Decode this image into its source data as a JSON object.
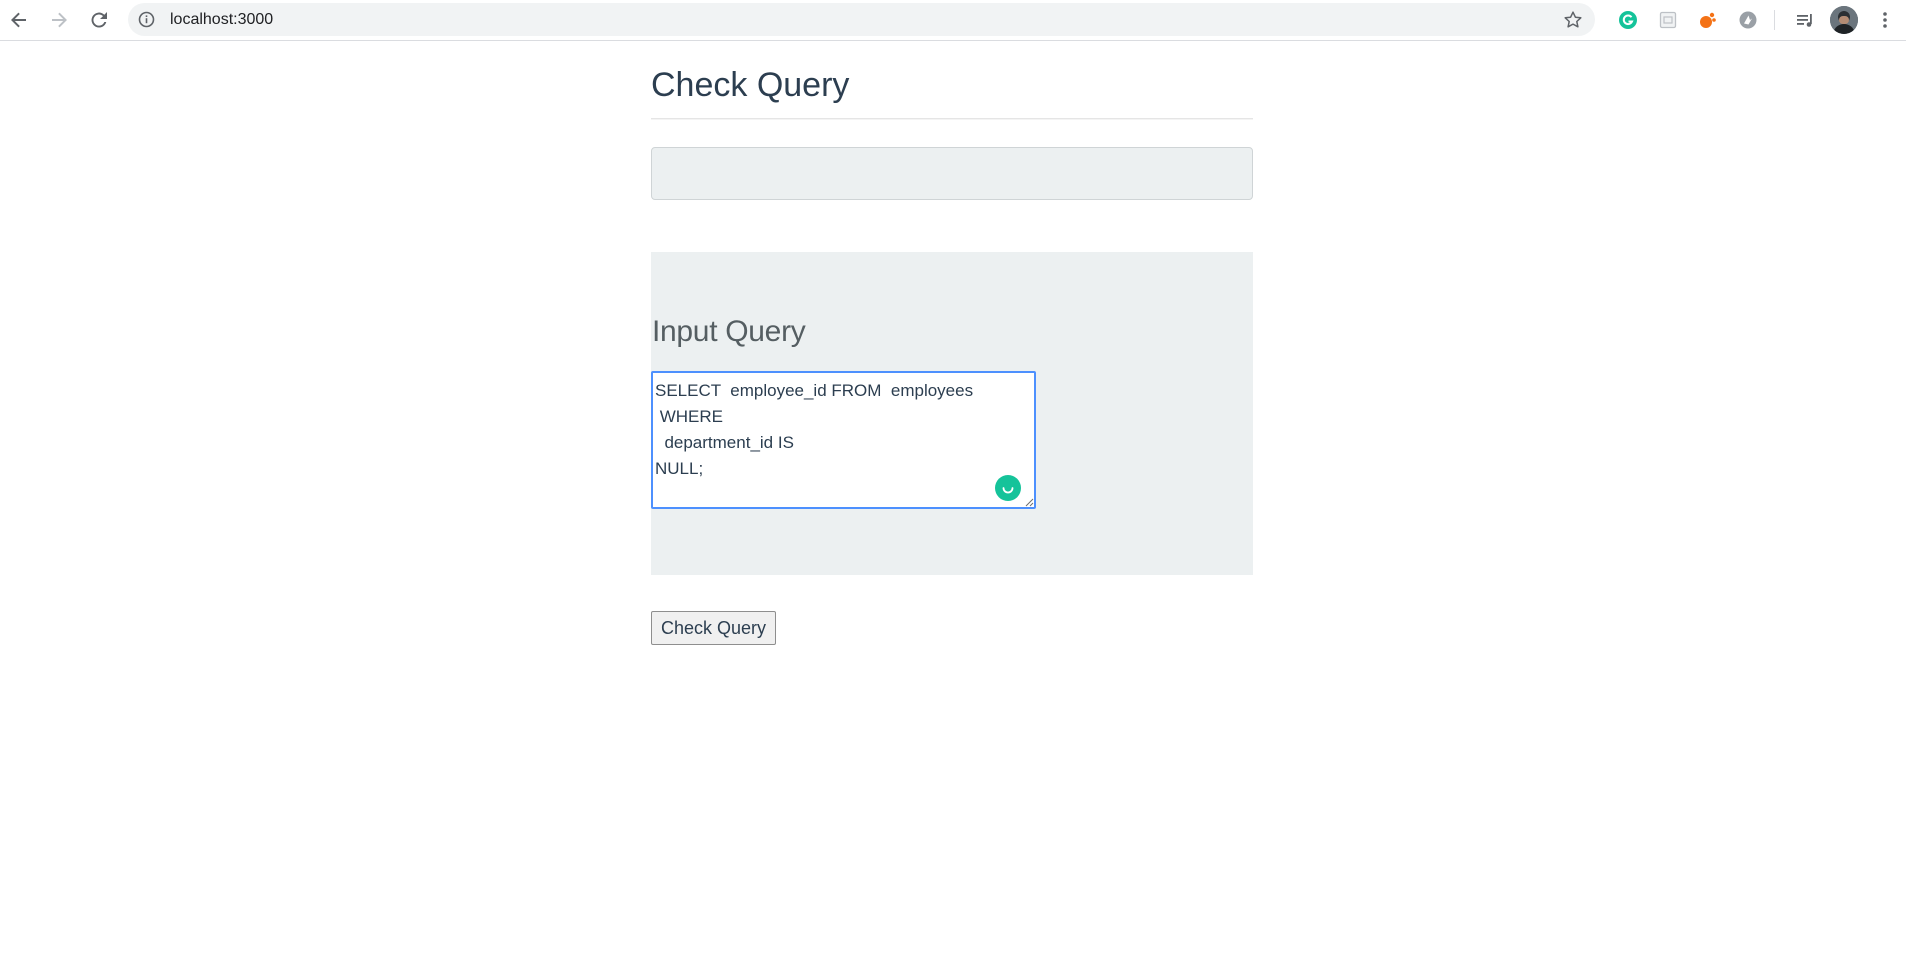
{
  "browser": {
    "url": "localhost:3000"
  },
  "page": {
    "title": "Check Query",
    "result_text": "",
    "input_heading": "Input Query",
    "query_text": "SELECT  employee_id FROM  employees\n WHERE\n  department_id IS\nNULL;",
    "submit_label": "Check Query"
  },
  "colors": {
    "heading": "#2c3e50",
    "panel_bg": "#ecf0f1",
    "focus_border": "#4d90fe",
    "grammarly": "#15c39a"
  },
  "icons": {
    "back": "arrow-left-icon",
    "forward": "arrow-right-icon",
    "reload": "reload-icon",
    "site_info": "info-icon",
    "bookmark": "star-icon",
    "extensions": [
      "grammarly-icon",
      "calendar-extension-icon",
      "orange-extension-icon",
      "grey-extension-icon"
    ],
    "media": "media-playlist-icon",
    "menu": "kebab-menu-icon"
  }
}
